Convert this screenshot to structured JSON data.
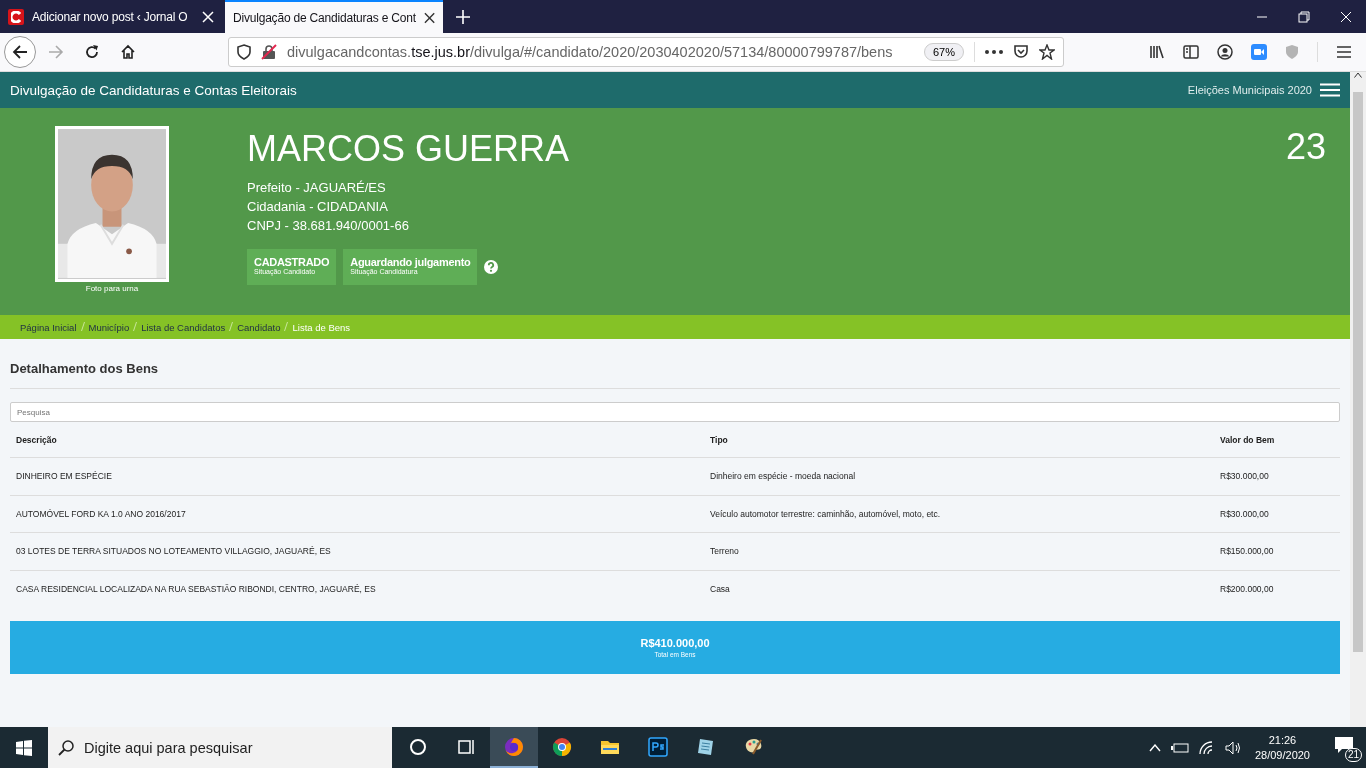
{
  "browser": {
    "tabs": [
      {
        "title": "Adicionar novo post ‹ Jornal O",
        "selected": false
      },
      {
        "title": "Divulgação de Candidaturas e Cont",
        "selected": true
      }
    ],
    "url": {
      "before_host": "divulgacandcontas.",
      "host": "tse.jus.br",
      "path": "/divulga/#/candidato/2020/2030402020/57134/80000799787/bens"
    },
    "zoom": "67%"
  },
  "site_header": {
    "title": "Divulgação de Candidaturas e Contas Eleitorais",
    "election": "Eleições Municipais 2020"
  },
  "candidate": {
    "name": "MARCOS GUERRA",
    "number": "23",
    "photo_caption": "Foto para urna",
    "details": [
      "Prefeito - JAGUARÉ/ES",
      "Cidadania - CIDADANIA",
      "CNPJ - 38.681.940/0001-66"
    ],
    "statuses": [
      {
        "value": "CADASTRADO",
        "label": "Situação Candidato"
      },
      {
        "value": "Aguardando julgamento",
        "label": "Situação Candidatura"
      }
    ]
  },
  "breadcrumb": [
    {
      "label": "Página Inicial",
      "current": false
    },
    {
      "label": "Município",
      "current": false
    },
    {
      "label": "Lista de Candidatos",
      "current": false
    },
    {
      "label": "Candidato",
      "current": false
    },
    {
      "label": "Lista de Bens",
      "current": true
    }
  ],
  "section_title": "Detalhamento dos Bens",
  "search": {
    "placeholder": "Pesquisa"
  },
  "table": {
    "columns": [
      "Descrição",
      "Tipo",
      "Valor do Bem"
    ],
    "rows": [
      [
        "DINHEIRO EM ESPÉCIE",
        "Dinheiro em espécie - moeda nacional",
        "R$30.000,00"
      ],
      [
        "AUTOMÓVEL FORD KA 1.0 ANO 2016/2017",
        "Veículo automotor terrestre: caminhão, automóvel, moto, etc.",
        "R$30.000,00"
      ],
      [
        "03 LOTES DE TERRA SITUADOS NO LOTEAMENTO VILLAGGIO, JAGUARÉ, ES",
        "Terreno",
        "R$150.000,00"
      ],
      [
        "CASA RESIDENCIAL LOCALIZADA NA RUA SEBASTIÃO RIBONDI, CENTRO, JAGUARÉ, ES",
        "Casa",
        "R$200.000,00"
      ]
    ]
  },
  "total": {
    "value": "R$410.000,00",
    "label": "Total em Bens"
  },
  "taskbar": {
    "search_placeholder": "Digite aqui para pesquisar",
    "apps": [
      {
        "kind": "cortana",
        "selected": false
      },
      {
        "kind": "task-view",
        "selected": false
      },
      {
        "kind": "firefox",
        "selected": true
      },
      {
        "kind": "chrome",
        "selected": false
      },
      {
        "kind": "folder",
        "selected": false
      },
      {
        "kind": "photoshop",
        "selected": false
      },
      {
        "kind": "notebook",
        "selected": false
      },
      {
        "kind": "palette",
        "selected": false
      }
    ],
    "time": "21:26",
    "date": "28/09/2020",
    "notifications": "21"
  }
}
